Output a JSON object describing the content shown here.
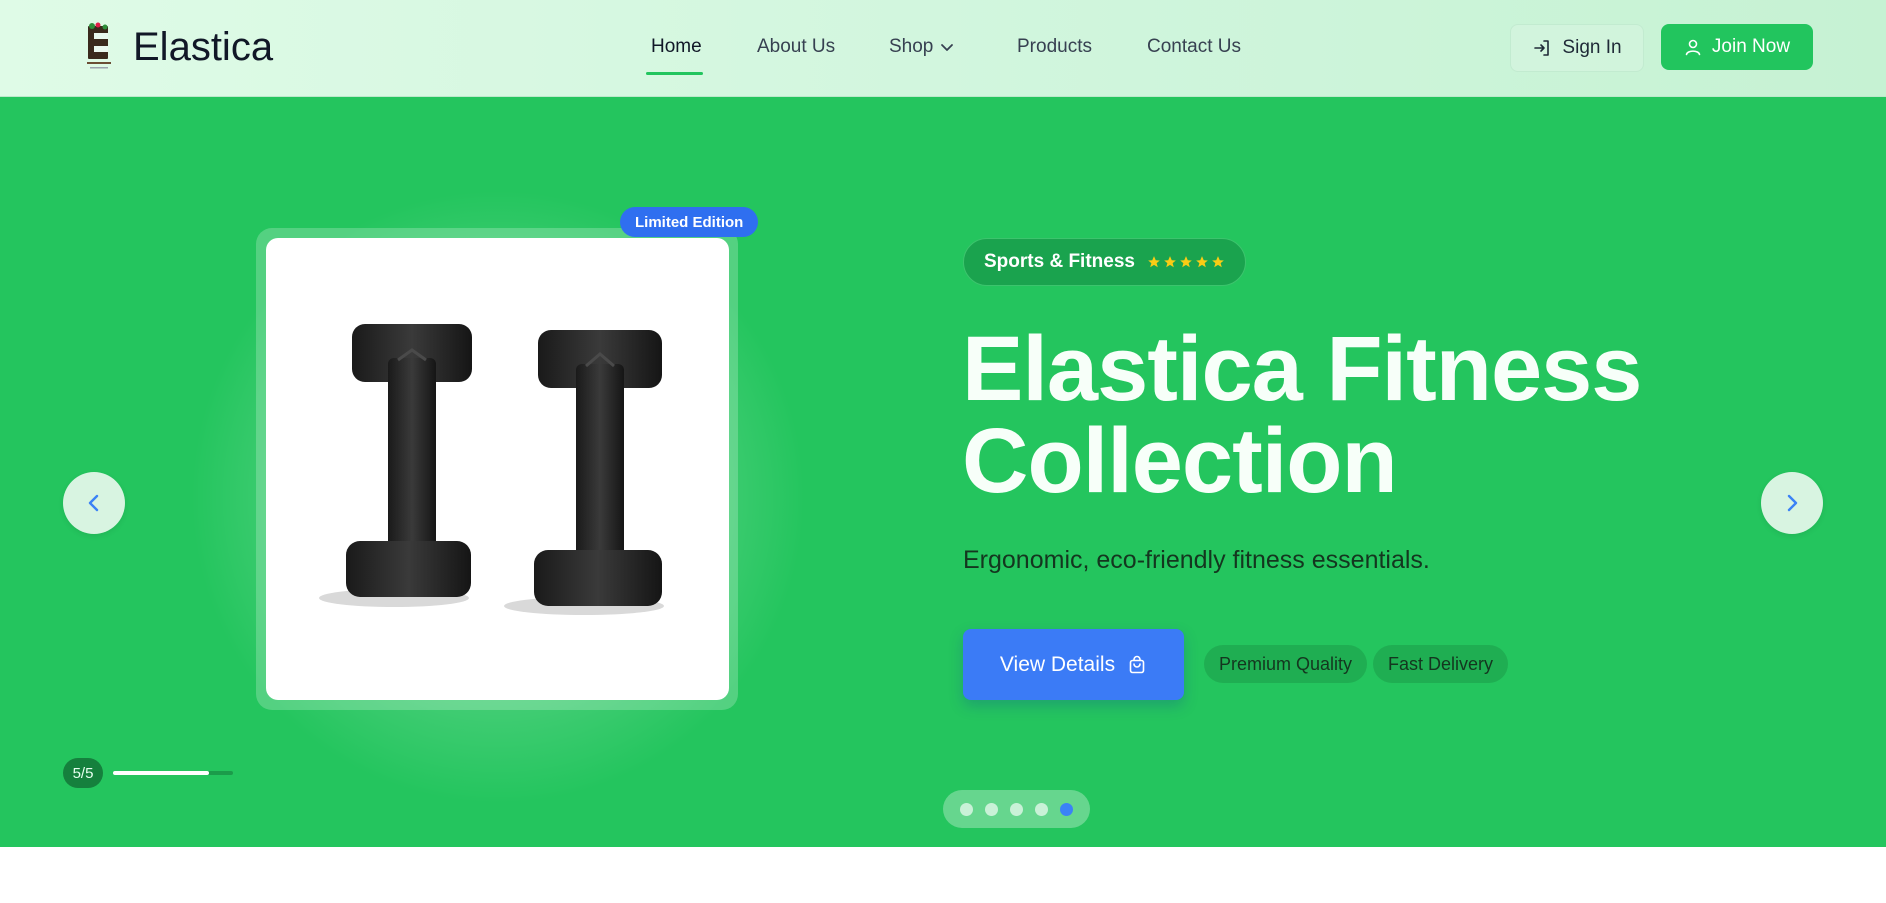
{
  "header": {
    "brand": "Elastica",
    "logo_icon": "elastica-logo-icon",
    "nav": [
      {
        "label": "Home",
        "active": true
      },
      {
        "label": "About Us"
      },
      {
        "label": "Shop",
        "has_dropdown": true
      },
      {
        "label": "Products"
      },
      {
        "label": "Contact Us"
      }
    ],
    "sign_in_label": "Sign In",
    "join_label": "Join Now"
  },
  "hero": {
    "badge": "Limited Edition",
    "category": "Sports & Fitness",
    "rating_stars": 5,
    "title_line1": "Elastica Fitness",
    "title_line2": "Collection",
    "subtitle": "Ergonomic, eco-friendly fitness essentials.",
    "cta_label": "View Details",
    "features": [
      "Premium Quality",
      "Fast Delivery"
    ],
    "slide_counter": "5/5",
    "slide_progress": 0.8,
    "slide_count": 5,
    "active_slide": 5
  },
  "colors": {
    "hero_bg": "#24c55e",
    "accent_green": "#22c55e",
    "primary_blue": "#3b7bf6",
    "star": "#facc15"
  }
}
